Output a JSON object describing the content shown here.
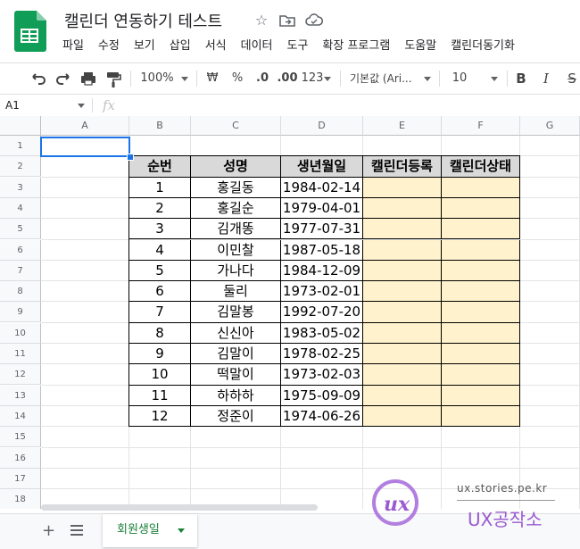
{
  "doc": {
    "title": "캘린더 연동하기 테스트"
  },
  "menu": [
    "파일",
    "수정",
    "보기",
    "삽입",
    "서식",
    "데이터",
    "도구",
    "확장 프로그램",
    "도움말",
    "캘린더동기화"
  ],
  "toolbar": {
    "zoom": "100%",
    "currency": "₩",
    "percent": "%",
    "dec_less": ".0",
    "dec_more": ".00",
    "more_formats": "123",
    "font": "기본값 (Ari...",
    "font_size": "10",
    "bold": "B",
    "italic": "I",
    "strike": "S"
  },
  "formula_bar": {
    "cell_ref": "A1",
    "fx": "fx",
    "value": ""
  },
  "columns": [
    "A",
    "B",
    "C",
    "D",
    "E",
    "F",
    "G"
  ],
  "rows": [
    "1",
    "2",
    "3",
    "4",
    "5",
    "6",
    "7",
    "8",
    "9",
    "10",
    "11",
    "12",
    "13",
    "14",
    "15",
    "16",
    "17",
    "18"
  ],
  "table": {
    "headers": [
      "순번",
      "성명",
      "생년월일",
      "캘린더등록",
      "캘린더상태"
    ],
    "rows": [
      [
        "1",
        "홍길동",
        "1984-02-14",
        "",
        ""
      ],
      [
        "2",
        "홍길순",
        "1979-04-01",
        "",
        ""
      ],
      [
        "3",
        "김개똥",
        "1977-07-31",
        "",
        ""
      ],
      [
        "4",
        "이민찰",
        "1987-05-18",
        "",
        ""
      ],
      [
        "5",
        "가나다",
        "1984-12-09",
        "",
        ""
      ],
      [
        "6",
        "둘리",
        "1973-02-01",
        "",
        ""
      ],
      [
        "7",
        "김말봉",
        "1992-07-20",
        "",
        ""
      ],
      [
        "8",
        "신신아",
        "1983-05-02",
        "",
        ""
      ],
      [
        "9",
        "김말이",
        "1978-02-25",
        "",
        ""
      ],
      [
        "10",
        "떡말이",
        "1973-02-03",
        "",
        ""
      ],
      [
        "11",
        "하하하",
        "1975-09-09",
        "",
        ""
      ],
      [
        "12",
        "정준이",
        "1974-06-26",
        "",
        ""
      ]
    ]
  },
  "sheet_tab": {
    "label": "회원생일"
  },
  "watermark": {
    "url": "ux.stories.pe.kr",
    "name": "UX공작소"
  },
  "colors": {
    "header_fill": "#d9d9d9",
    "pending_fill": "#fff2cc",
    "selection": "#1a73e8",
    "sheets_green": "#188038"
  }
}
